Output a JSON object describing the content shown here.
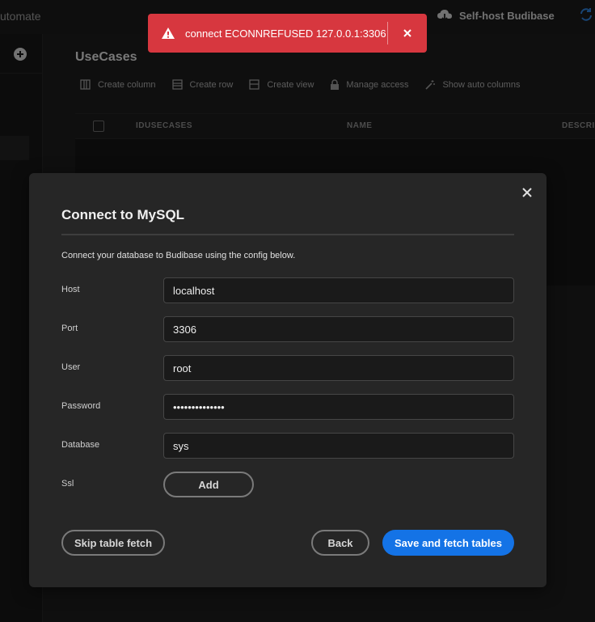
{
  "app": {
    "nav_automate": "utomate",
    "selfhost_label": "Self-host Budibase"
  },
  "table": {
    "title": "UseCases",
    "toolbar": [
      {
        "label": "Create column",
        "icon": "create-column-icon"
      },
      {
        "label": "Create row",
        "icon": "create-row-icon"
      },
      {
        "label": "Create view",
        "icon": "create-view-icon"
      },
      {
        "label": "Manage access",
        "icon": "lock-icon"
      },
      {
        "label": "Show auto columns",
        "icon": "magic-wand-icon"
      }
    ],
    "columns": [
      "IDUSECASES",
      "NAME",
      "DESCRI"
    ]
  },
  "toast": {
    "message": "connect ECONNREFUSED 127.0.0.1:3306",
    "color": "#d7373f"
  },
  "modal": {
    "title": "Connect to MySQL",
    "description": "Connect your database to Budibase using the config below.",
    "fields": {
      "host": {
        "label": "Host",
        "value": "localhost"
      },
      "port": {
        "label": "Port",
        "value": "3306"
      },
      "user": {
        "label": "User",
        "value": "root"
      },
      "password": {
        "label": "Password",
        "value": "••••••••••••••"
      },
      "database": {
        "label": "Database",
        "value": "sys"
      },
      "ssl": {
        "label": "Ssl",
        "button": "Add"
      }
    },
    "buttons": {
      "skip": "Skip table fetch",
      "back": "Back",
      "save": "Save and fetch tables"
    },
    "accent": "#1473e6"
  }
}
